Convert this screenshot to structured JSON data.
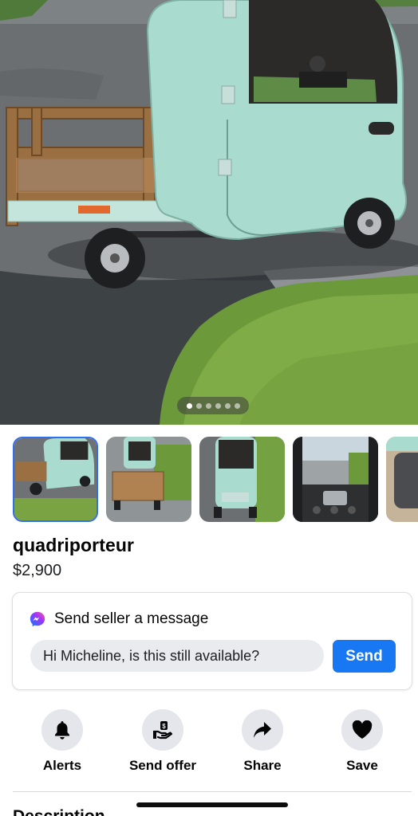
{
  "listing": {
    "title": "quadriporteur",
    "price": "$2,900",
    "photo_count": 6,
    "active_photo_index": 0,
    "hero_photo": "light teal enclosed mobility scooter with wooden cargo bed parked on asphalt next to grass"
  },
  "thumbnails": [
    {
      "name": "thumbnail-side-view",
      "selected": true
    },
    {
      "name": "thumbnail-rear-cargo"
    },
    {
      "name": "thumbnail-rear-view"
    },
    {
      "name": "thumbnail-dashboard"
    },
    {
      "name": "thumbnail-seat"
    }
  ],
  "message": {
    "heading": "Send seller a message",
    "input_value": "Hi Micheline, is this still available?",
    "send_label": "Send"
  },
  "actions": {
    "alerts": "Alerts",
    "send_offer": "Send offer",
    "share": "Share",
    "save": "Save"
  },
  "description_heading": "Description",
  "colors": {
    "accent": "#1877f2",
    "action_circle": "#e4e6eb",
    "vehicle": "#a9dccf"
  }
}
